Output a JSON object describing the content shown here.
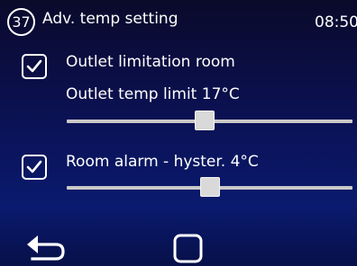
{
  "header": {
    "page_number": "37",
    "title": "Adv. temp setting",
    "time": "08:50"
  },
  "settings": {
    "outlet_limitation": {
      "label": "Outlet limitation room",
      "checked": true
    },
    "outlet_temp_limit": {
      "label": "Outlet temp limit 17°C",
      "slider_level_percent": 48
    },
    "room_alarm": {
      "label": "Room alarm - hyster.  4°C",
      "checked": true,
      "slider_level_percent": 50
    }
  },
  "footer": {
    "back_icon": "back-arrow-icon",
    "home_icon": "home-square-icon"
  },
  "colors": {
    "text": "#ffffff",
    "background_top": "#0a0a2a",
    "background_bottom": "#0a1a6e",
    "slider_track": "#c9c9c9",
    "slider_thumb": "#d9d9d9"
  }
}
